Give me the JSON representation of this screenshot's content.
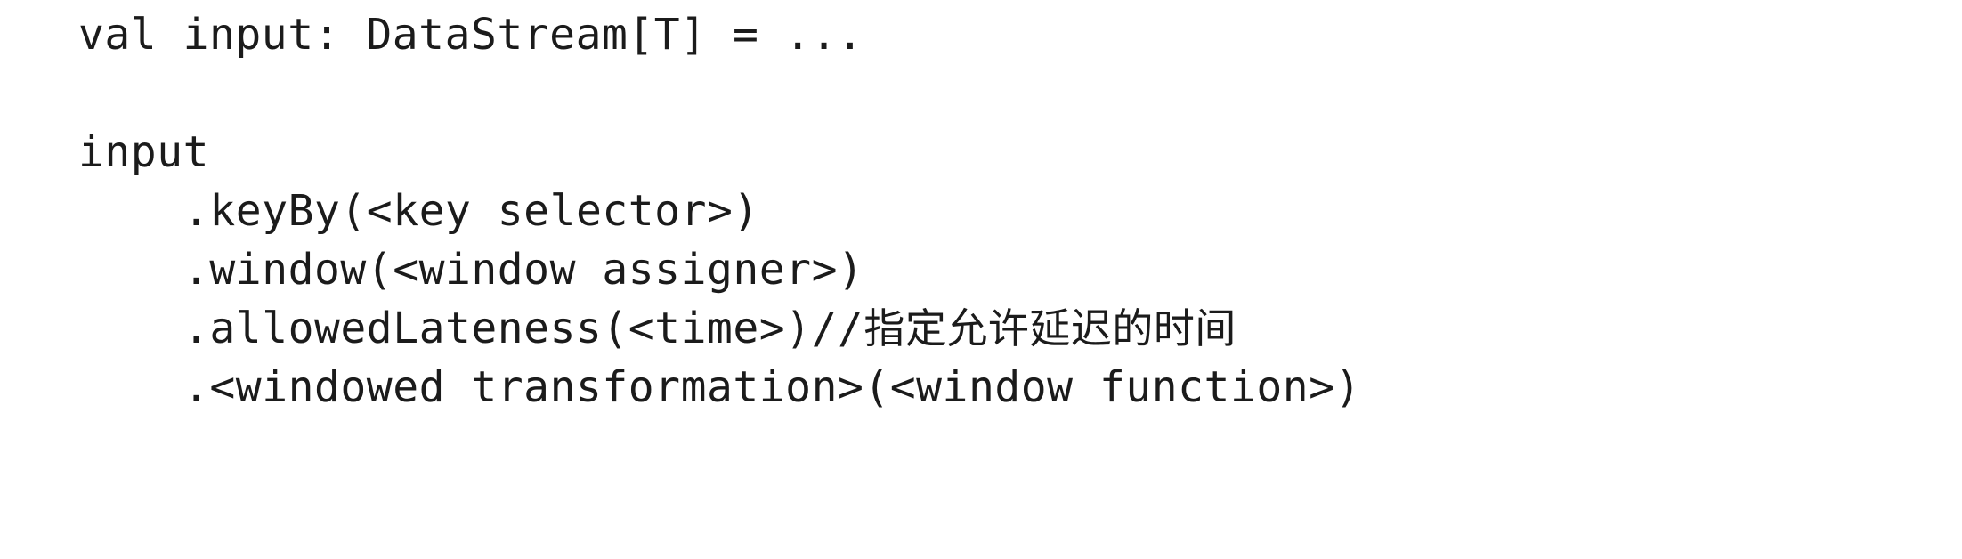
{
  "document": {
    "kind": "code-snippet",
    "language": "scala",
    "background_color": "#ffffff",
    "text_color": "#1b1b1b"
  },
  "code": {
    "lines": [
      {
        "id": "declaration",
        "indent": 0,
        "text": "val input: DataStream[T] = ..."
      },
      {
        "id": "blank",
        "indent": 0,
        "text": " "
      },
      {
        "id": "stream-root",
        "indent": 0,
        "text": "input"
      },
      {
        "id": "key-by",
        "indent": 1,
        "text": ".keyBy(<key selector>)"
      },
      {
        "id": "window",
        "indent": 1,
        "text": ".window(<window assigner>)"
      },
      {
        "id": "allowed-lateness",
        "indent": 1,
        "text": ".allowedLateness(<time>)//",
        "comment_cjk": "指定允许延迟的时间"
      },
      {
        "id": "windowed-transformation",
        "indent": 1,
        "text": ".<windowed transformation>(<window function>)"
      }
    ]
  }
}
